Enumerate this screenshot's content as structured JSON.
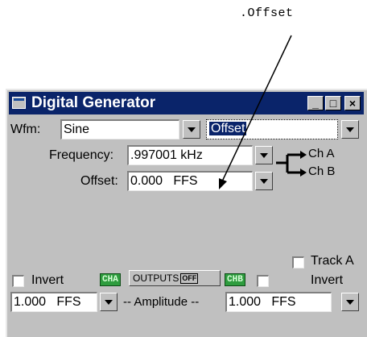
{
  "callout": {
    "text": ".Offset"
  },
  "window": {
    "title": "Digital Generator",
    "controls": {
      "minimize": "_",
      "maximize": "□",
      "close": "×"
    }
  },
  "waveform": {
    "label": "Wfm:",
    "value": "Sine",
    "secondary_value": "Offset"
  },
  "frequency": {
    "label": "Frequency:",
    "value": ".997001 kHz"
  },
  "offset": {
    "label": "Offset:",
    "value": "0.000   FFS"
  },
  "channels": {
    "a": "Ch A",
    "b": "Ch B"
  },
  "track": {
    "label": "Track A",
    "checked": false
  },
  "invert_left": {
    "label": "Invert",
    "checked": false
  },
  "invert_right": {
    "label": "Invert",
    "checked": false
  },
  "badges": {
    "cha": "CHA",
    "chb": "CHB"
  },
  "outputs": {
    "label": "OUTPUTS",
    "state": "OFF"
  },
  "amplitude": {
    "label": "-- Amplitude --",
    "left_value": "1.000   FFS",
    "right_value": "1.000   FFS"
  },
  "colors": {
    "titlebar": "#0a246a",
    "window": "#c0c0c0",
    "badge": "#2e9c3e"
  }
}
